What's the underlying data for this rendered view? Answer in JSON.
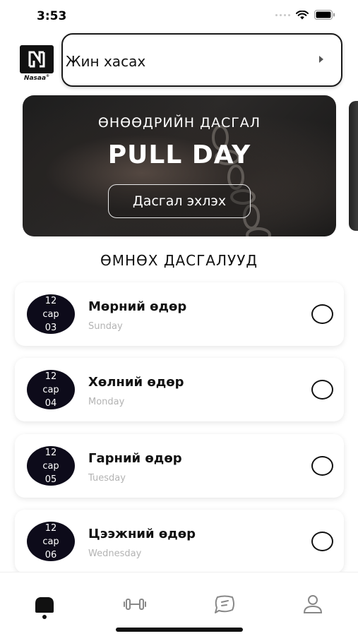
{
  "status_bar": {
    "time": "3:53"
  },
  "logo": {
    "text": "Nasaa",
    "trademark": "®"
  },
  "gym_select": {
    "value": "Жин хасах"
  },
  "banner": {
    "subtitle": "ӨНӨӨДРИЙН ДАСГАЛ",
    "title": "PULL DAY",
    "button_label": "Дасгал эхлэх"
  },
  "section_title": "ӨМНӨХ ДАСГАЛУУД",
  "workouts": [
    {
      "day": "12",
      "month": "сар",
      "date": "03",
      "title": "Мөрний өдөр",
      "weekday": "Sunday",
      "completed": false
    },
    {
      "day": "12",
      "month": "сар",
      "date": "04",
      "title": "Хөлний өдөр",
      "weekday": "Monday",
      "completed": false
    },
    {
      "day": "12",
      "month": "сар",
      "date": "05",
      "title": "Гарний өдөр",
      "weekday": "Tuesday",
      "completed": false
    },
    {
      "day": "12",
      "month": "сар",
      "date": "06",
      "title": "Цээжний өдөр",
      "weekday": "Wednesday",
      "completed": false
    }
  ],
  "tab_bar": {
    "tabs": [
      {
        "icon": "home-icon",
        "active": true
      },
      {
        "icon": "dumbbell-icon",
        "active": false
      },
      {
        "icon": "chat-icon",
        "active": false
      },
      {
        "icon": "profile-icon",
        "active": false
      }
    ]
  },
  "colors": {
    "badge_bg": "#0d0b1a",
    "subtext": "#b3b3b3",
    "accent": "#111111"
  }
}
